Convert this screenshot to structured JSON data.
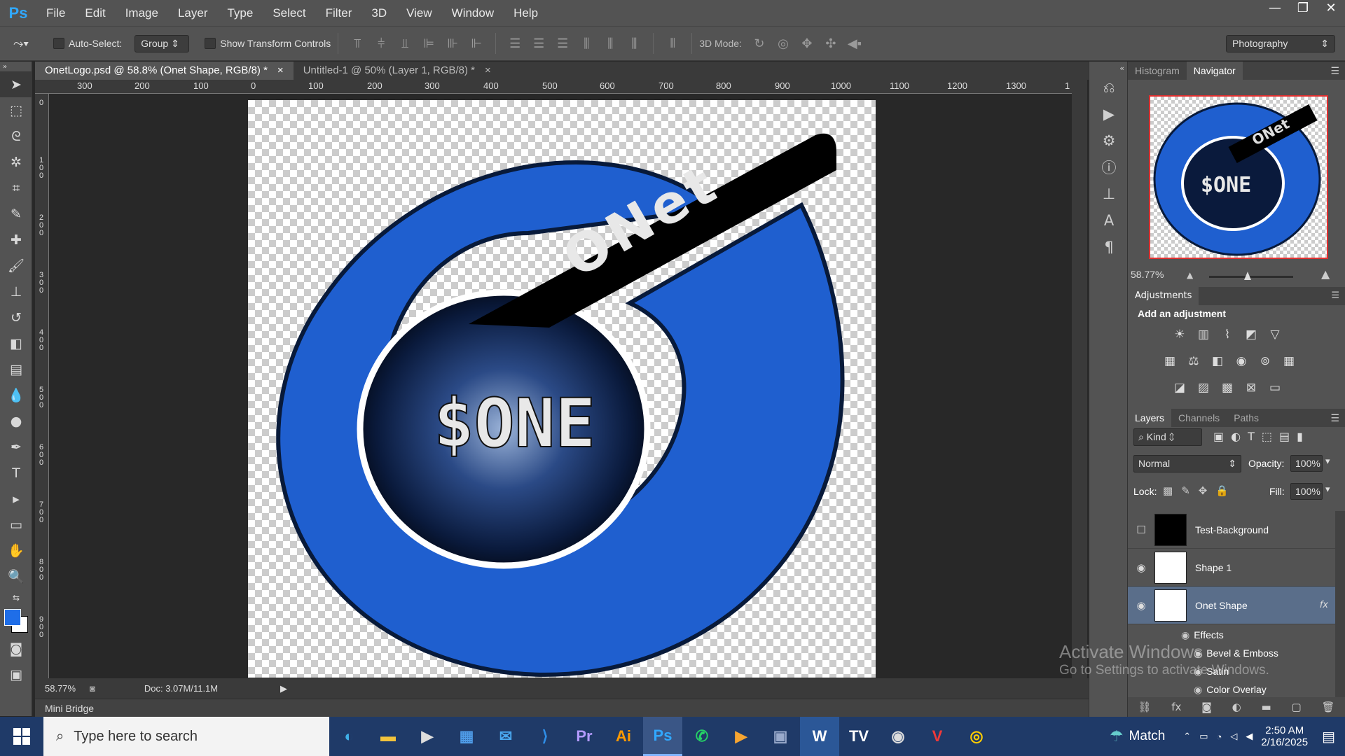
{
  "app": {
    "logo": "Ps",
    "menus": [
      "File",
      "Edit",
      "Image",
      "Layer",
      "Type",
      "Select",
      "Filter",
      "3D",
      "View",
      "Window",
      "Help"
    ]
  },
  "window_controls": {
    "minimize": "—",
    "restore": "❐",
    "close": "✕"
  },
  "options": {
    "auto_select_label": "Auto-Select:",
    "auto_select_value": "Group",
    "show_transform_label": "Show Transform Controls",
    "mode_3d_label": "3D Mode:",
    "workspace": "Photography"
  },
  "tabs": [
    {
      "label": "OnetLogo.psd @ 58.8% (Onet Shape, RGB/8) *",
      "close": "×"
    },
    {
      "label": "Untitled-1 @ 50% (Layer 1, RGB/8) *",
      "close": "×"
    }
  ],
  "ruler_top": [
    "300",
    "200",
    "100",
    "0",
    "100",
    "200",
    "300",
    "400",
    "500",
    "600",
    "700",
    "800",
    "900",
    "1000",
    "1100",
    "1200",
    "1300",
    "1"
  ],
  "ruler_left": [
    "0",
    "1 0 0",
    "2 0 0",
    "3 0 0",
    "4 0 0",
    "5 0 0",
    "6 0 0",
    "7 0 0",
    "8 0 0",
    "9 0 0"
  ],
  "artwork": {
    "ring_text": "ONet",
    "center_text": "$ONE",
    "ring_color": "#1f5fcf"
  },
  "status": {
    "zoom": "58.77%",
    "doc": "Doc: 3.07M/11.1M"
  },
  "mini_bridge": "Mini Bridge",
  "navigator": {
    "tabs": [
      "Histogram",
      "Navigator"
    ],
    "zoom": "58.77%"
  },
  "adjustments": {
    "title": "Adjustments",
    "subtitle": "Add an adjustment"
  },
  "layers_panel": {
    "tabs": [
      "Layers",
      "Channels",
      "Paths"
    ],
    "kind": "Kind",
    "blend_mode": "Normal",
    "opacity_label": "Opacity:",
    "opacity": "100%",
    "lock_label": "Lock:",
    "fill_label": "Fill:",
    "fill": "100%",
    "layers": [
      {
        "name": "Test-Background"
      },
      {
        "name": "Shape 1"
      },
      {
        "name": "Onet Shape",
        "fx": "fx"
      }
    ],
    "effects_label": "Effects",
    "effects": [
      "Bevel & Emboss",
      "Satin",
      "Color Overlay"
    ]
  },
  "watermark": {
    "line1": "Activate Windows",
    "line2": "Go to Settings to activate Windows."
  },
  "taskbar": {
    "search_placeholder": "Type here to search",
    "weather": "Match",
    "time": "2:50 AM",
    "date": "2/16/2025",
    "apps": [
      "Edge",
      "File Explorer",
      "Media",
      "Store",
      "Mail",
      "VS Code",
      "Pr",
      "Ai",
      "Ps",
      "WhatsApp",
      "Slides",
      "Remote",
      "W",
      "TV",
      "OBS",
      "Vivaldi",
      "Chrome"
    ]
  }
}
